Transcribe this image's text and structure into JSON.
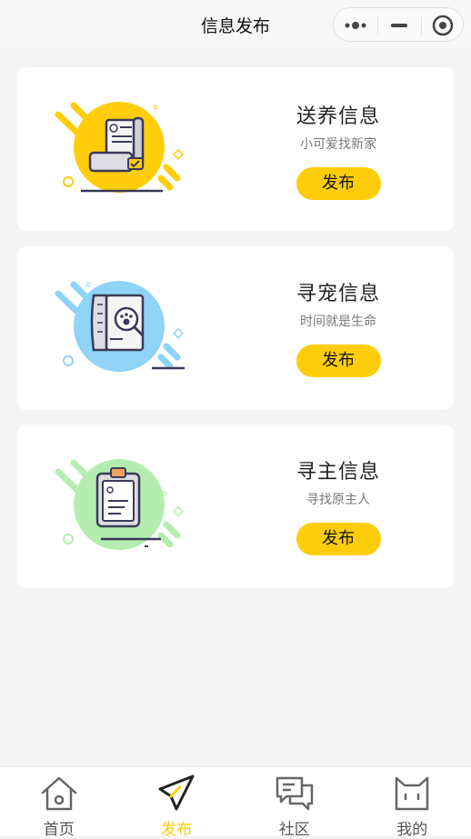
{
  "nav": {
    "title": "信息发布"
  },
  "capsule": {
    "more_icon": "dots-icon",
    "minimize_icon": "minus-icon",
    "close_icon": "target-icon"
  },
  "cards": [
    {
      "title": "送养信息",
      "subtitle": "小可爱找新家",
      "button": "发布",
      "icon": "certificate-icon",
      "color": "#ffcd0a"
    },
    {
      "title": "寻宠信息",
      "subtitle": "时间就是生命",
      "button": "发布",
      "icon": "paw-search-icon",
      "color": "#8fd3f7"
    },
    {
      "title": "寻主信息",
      "subtitle": "寻找原主人",
      "button": "发布",
      "icon": "clipboard-icon",
      "color": "#b5edb1"
    }
  ],
  "tabs": [
    {
      "label": "首页",
      "icon": "home-icon",
      "active": false
    },
    {
      "label": "发布",
      "icon": "send-icon",
      "active": true
    },
    {
      "label": "社区",
      "icon": "chat-icon",
      "active": false
    },
    {
      "label": "我的",
      "icon": "cat-icon",
      "active": false
    }
  ],
  "colors": {
    "accent": "#fecd0a",
    "background": "#f4f4f4"
  }
}
